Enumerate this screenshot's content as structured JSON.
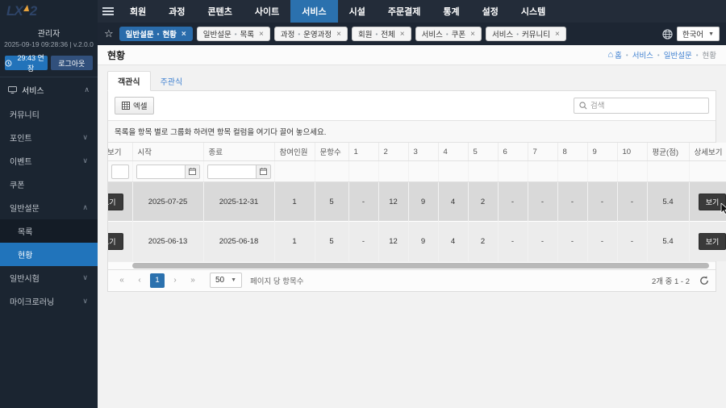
{
  "colors": {
    "sidebar_bg": "#1b2531",
    "sidebar_sub_bg": "#141c26",
    "topnav_bg": "#232c39",
    "tabstrip_bg": "#1d2633",
    "accent_blue": "#2174bb",
    "active_chip_blue": "#2a6cab",
    "link_blue": "#3d7fd0",
    "logo_navy": "#2e4468",
    "logo_yellow": "#e8a33d",
    "dark_button": "#3a3a3a",
    "row_selected": "#d9d9d9",
    "row_alt": "#ececec"
  },
  "logo": {
    "text": "LX",
    "sup": "2"
  },
  "topnav": {
    "items": [
      "회원",
      "과정",
      "콘텐츠",
      "사이트",
      "서비스",
      "시설",
      "주문결제",
      "통계",
      "설정",
      "시스템"
    ],
    "active_index": 4,
    "language": "한국어"
  },
  "sidebar": {
    "admin_name": "관리자",
    "session_info": "2025-09-19 09:28:36 | v.2.0.0",
    "extend_button": "29:43 연장",
    "logout_button": "로그아웃",
    "section_label": "서비스",
    "items": [
      {
        "label": "커뮤니티",
        "chevron": ""
      },
      {
        "label": "포인트",
        "chevron": "down"
      },
      {
        "label": "이벤트",
        "chevron": "down"
      },
      {
        "label": "쿠폰",
        "chevron": ""
      },
      {
        "label": "일반설문",
        "chevron": "up"
      },
      {
        "label": "목록",
        "sub": true
      },
      {
        "label": "현황",
        "sub": true,
        "active": true
      },
      {
        "label": "일반시험",
        "chevron": "down"
      },
      {
        "label": "마이크로러닝",
        "chevron": "down"
      }
    ]
  },
  "open_tabs": [
    {
      "group": "일반설문",
      "page": "현황",
      "active": true
    },
    {
      "group": "일반설문",
      "page": "목록"
    },
    {
      "group": "과정",
      "page": "운영과정"
    },
    {
      "group": "회원",
      "page": "전체"
    },
    {
      "group": "서비스",
      "page": "쿠폰"
    },
    {
      "group": "서비스",
      "page": "커뮤니티"
    }
  ],
  "page": {
    "title": "현황",
    "breadcrumb": [
      "홈",
      "서비스",
      "일반설문",
      "현황"
    ]
  },
  "content": {
    "view_tabs": [
      {
        "label": "객관식",
        "active": true
      },
      {
        "label": "주관식",
        "active": false
      }
    ],
    "excel_button": "엑셀",
    "search_placeholder": "검색",
    "group_hint": "목록을 항목 별로 그룹화 하려면 항목 컬럼을 여기다 끌어 놓으세요.",
    "table": {
      "columns": [
        "보기",
        "시작",
        "종료",
        "참여인원",
        "문항수",
        "1",
        "2",
        "3",
        "4",
        "5",
        "6",
        "7",
        "8",
        "9",
        "10",
        "평균(점)",
        "상세보기"
      ],
      "rows": [
        {
          "cells": [
            "보기",
            "2025-07-25",
            "2025-12-31",
            "1",
            "5",
            "-",
            "12",
            "9",
            "4",
            "2",
            "-",
            "-",
            "-",
            "-",
            "-",
            "5.4",
            "보기"
          ],
          "selected": true,
          "cursor": true
        },
        {
          "cells": [
            "보기",
            "2025-06-13",
            "2025-06-18",
            "1",
            "5",
            "-",
            "12",
            "9",
            "4",
            "2",
            "-",
            "-",
            "-",
            "-",
            "-",
            "5.4",
            "보기"
          ],
          "selected": false,
          "cursor": false
        }
      ]
    },
    "pagination": {
      "current_page": "1",
      "page_size": "50",
      "per_page_label": "페이지 당 항목수",
      "range_label": "2개 중 1 - 2"
    }
  }
}
